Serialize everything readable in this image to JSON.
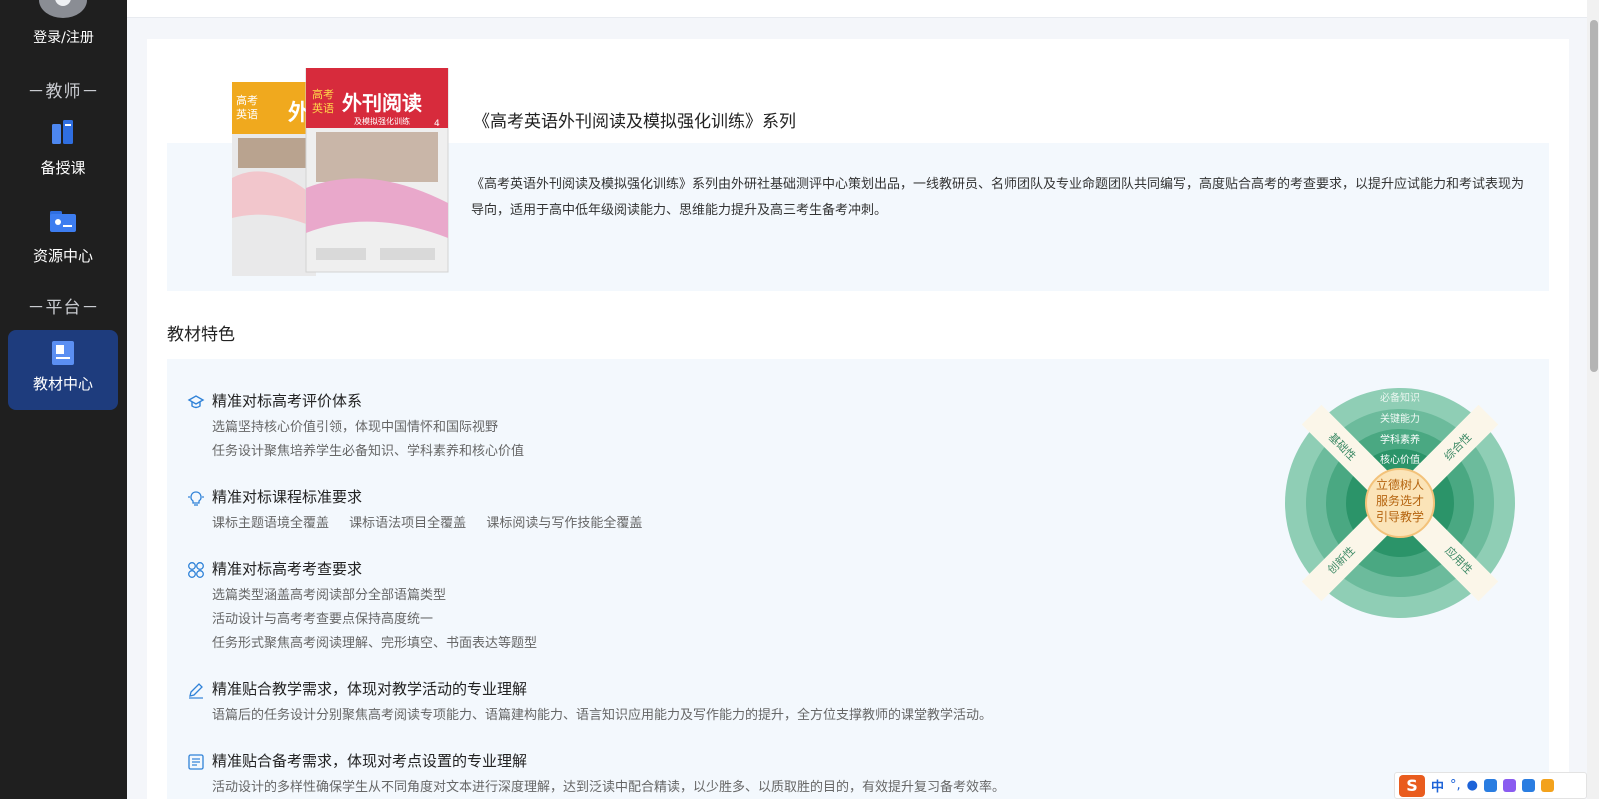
{
  "sidebar": {
    "login_label": "登录/注册",
    "teacher_section": "－教师－",
    "platform_section": "－平台－",
    "items": [
      {
        "label": "备授课",
        "icon": "books-icon"
      },
      {
        "label": "资源中心",
        "icon": "folder-card-icon"
      },
      {
        "label": "教材中心",
        "icon": "textbook-icon",
        "active": true
      }
    ]
  },
  "series": {
    "title": "《高考英语外刊阅读及模拟强化训练》系列",
    "description": "《高考英语外刊阅读及模拟强化训练》系列由外研社基础测评中心策划出品，一线教研员、名师团队及专业命题团队共同编写，高度贴合高考的考查要求，以提升应试能力和考试表现为导向，适用于高中低年级阅读能力、思维能力提升及高三考生备考冲刺。",
    "book_cover": {
      "front_top": "高考",
      "front_top2": "英语",
      "front_title": "外刊阅读",
      "front_subtitle": "及模拟强化训练",
      "front_number": "4",
      "back_top": "高考",
      "back_top2": "英语",
      "back_title": "外"
    }
  },
  "features": {
    "heading": "教材特色",
    "items": [
      {
        "title": "精准对标高考评价体系",
        "icon": "graduation-cap-icon",
        "lines": [
          "选篇坚持核心价值引领，体现中国情怀和国际视野",
          "任务设计聚焦培养学生必备知识、学科素养和核心价值"
        ]
      },
      {
        "title": "精准对标课程标准要求",
        "icon": "lightbulb-icon",
        "inline": [
          "课标主题语境全覆盖",
          "课标语法项目全覆盖",
          "课标阅读与写作技能全覆盖"
        ]
      },
      {
        "title": "精准对标高考考查要求",
        "icon": "clover-icon",
        "lines": [
          "选篇类型涵盖高考阅读部分全部语篇类型",
          "活动设计与高考考查要点保持高度统一",
          "任务形式聚焦高考阅读理解、完形填空、书面表达等题型"
        ]
      },
      {
        "title": "精准贴合教学需求，体现对教学活动的专业理解",
        "icon": "pen-icon",
        "lines": [
          "语篇后的任务设计分别聚焦高考阅读专项能力、语篇建构能力、语言知识应用能力及写作能力的提升，全方位支撑教师的课堂教学活动。"
        ]
      },
      {
        "title": "精准贴合备考需求，体现对考点设置的专业理解",
        "icon": "list-icon",
        "lines": [
          "活动设计的多样性确保学生从不同角度对文本进行深度理解，达到泛读中配合精读，以少胜多、以质取胜的目的，有效提升复习备考效率。"
        ]
      }
    ]
  },
  "diagram": {
    "rings": [
      "必备知识",
      "关键能力",
      "学科素养",
      "核心价值"
    ],
    "center": [
      "立德树人",
      "服务选才",
      "引导教学"
    ],
    "diagonals": [
      "基础性",
      "综合性",
      "创新性",
      "应用性"
    ],
    "colors": {
      "outer": "#8fceb5",
      "ring2": "#6cbb9c",
      "ring3": "#4aa882",
      "ring4": "#2b9469",
      "center": "#fbe4b8",
      "center_text": "#b5640f",
      "band": "#fbf6e9"
    }
  },
  "ime": {
    "logo": "S",
    "lang": "中"
  }
}
